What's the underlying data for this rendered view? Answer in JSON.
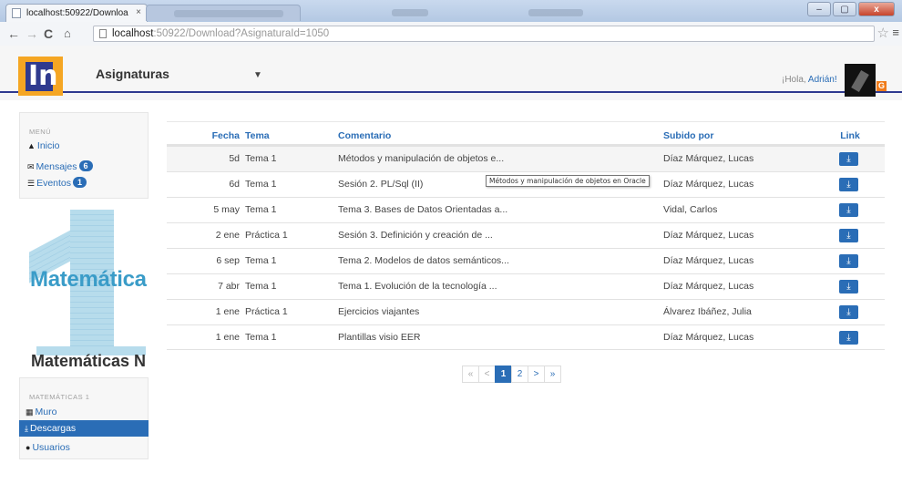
{
  "browser": {
    "tab_title": "localhost:50922/Downloa",
    "tab_close": "×",
    "url_host": "localhost",
    "url_rest": ":50922/Download?AsignaturaId=1050",
    "window_controls": {
      "minimize": "–",
      "maximize": "▢",
      "close": "x"
    }
  },
  "header": {
    "logo_text": "In",
    "menu_title": "Asignaturas",
    "caret": "▼",
    "greeting": "¡Hola, ",
    "user_name": "Adrián!",
    "logout_icon": "G"
  },
  "sidebar": {
    "menu_label": "MENÚ",
    "items": [
      {
        "icon": "home-icon",
        "glyph": "🏠",
        "label": "Inicio"
      },
      {
        "icon": "envelope-icon",
        "glyph": "✉",
        "label": "Mensajes",
        "badge": "6"
      },
      {
        "icon": "list-icon",
        "glyph": "☰",
        "label": "Eventos",
        "badge": "1"
      }
    ],
    "course_art_word": "Matemática",
    "course_name": "Matemáticas N",
    "course_label": "MATEMÁTICAS 1",
    "course_items": [
      {
        "icon": "grid-icon",
        "glyph": "▦",
        "label": "Muro"
      },
      {
        "icon": "download-icon",
        "glyph": "⤓",
        "label": "Descargas",
        "active": true
      },
      {
        "icon": "user-icon",
        "glyph": "👤",
        "label": "Usuarios"
      }
    ]
  },
  "table": {
    "headers": {
      "fecha": "Fecha",
      "tema": "Tema",
      "comentario": "Comentario",
      "subido_por": "Subido por",
      "link": "Link"
    },
    "rows": [
      {
        "fecha": "5d",
        "tema": "Tema 1",
        "comentario": "Métodos y manipulación de objetos e...",
        "subido_por": "Díaz Márquez, Lucas"
      },
      {
        "fecha": "6d",
        "tema": "Tema 1",
        "comentario": "Sesión 2. PL/Sql (II)",
        "subido_por": "Díaz Márquez, Lucas"
      },
      {
        "fecha": "5 may",
        "tema": "Tema 1",
        "comentario": "Tema 3. Bases de Datos Orientadas a...",
        "subido_por": "Vidal, Carlos"
      },
      {
        "fecha": "2 ene",
        "tema": "Práctica 1",
        "comentario": "Sesión 3. Definición y creación de ...",
        "subido_por": "Díaz Márquez, Lucas"
      },
      {
        "fecha": "6 sep",
        "tema": "Tema 1",
        "comentario": "Tema 2. Modelos de datos semánticos...",
        "subido_por": "Díaz Márquez, Lucas"
      },
      {
        "fecha": "7 abr",
        "tema": "Tema 1",
        "comentario": "Tema 1. Evolución de la tecnología ...",
        "subido_por": "Díaz Márquez, Lucas"
      },
      {
        "fecha": "1 ene",
        "tema": "Práctica 1",
        "comentario": "Ejercicios viajantes",
        "subido_por": "Álvarez Ibáñez, Julia"
      },
      {
        "fecha": "1 ene",
        "tema": "Tema 1",
        "comentario": "Plantillas visio EER",
        "subido_por": "Díaz Márquez, Lucas"
      }
    ],
    "tooltip": "Métodos y manipulación de objetos en Oracle"
  },
  "pagination": {
    "first": "«",
    "prev": "<",
    "pages": [
      "1",
      "2"
    ],
    "next": ">",
    "last": "»"
  },
  "colors": {
    "accent": "#2a6db6",
    "brand_navy": "#2f3a8f",
    "brand_orange": "#f5a623",
    "course_blue": "#3a9cc8"
  }
}
